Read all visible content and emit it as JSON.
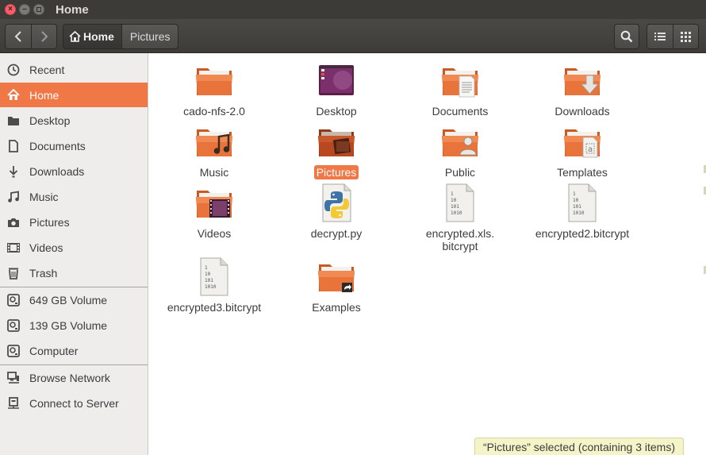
{
  "window": {
    "title": "Home"
  },
  "toolbar": {
    "back_icon": "chevron-left",
    "forward_icon": "chevron-right",
    "breadcrumbs": [
      "Home",
      "Pictures"
    ],
    "search_icon": "search",
    "list_view_icon": "list-view",
    "grid_view_icon": "grid-view"
  },
  "sidebar": {
    "items": [
      {
        "label": "Recent",
        "icon": "clock-icon"
      },
      {
        "label": "Home",
        "icon": "home-icon",
        "selected": true
      },
      {
        "label": "Desktop",
        "icon": "folder-icon"
      },
      {
        "label": "Documents",
        "icon": "document-icon"
      },
      {
        "label": "Downloads",
        "icon": "download-icon"
      },
      {
        "label": "Music",
        "icon": "music-icon"
      },
      {
        "label": "Pictures",
        "icon": "camera-icon"
      },
      {
        "label": "Videos",
        "icon": "film-icon"
      },
      {
        "label": "Trash",
        "icon": "trash-icon"
      }
    ],
    "devices": [
      {
        "label": "649 GB Volume",
        "icon": "drive-icon"
      },
      {
        "label": "139 GB Volume",
        "icon": "drive-icon"
      },
      {
        "label": "Computer",
        "icon": "drive-icon"
      }
    ],
    "network": [
      {
        "label": "Browse Network",
        "icon": "network-icon"
      },
      {
        "label": "Connect to Server",
        "icon": "server-icon"
      }
    ]
  },
  "files": [
    {
      "name": "cado-nfs-2.0",
      "type": "folder"
    },
    {
      "name": "Desktop",
      "type": "desktop-folder"
    },
    {
      "name": "Documents",
      "type": "documents-folder"
    },
    {
      "name": "Downloads",
      "type": "downloads-folder"
    },
    {
      "name": "Music",
      "type": "music-folder"
    },
    {
      "name": "Pictures",
      "type": "pictures-folder",
      "selected": true
    },
    {
      "name": "Public",
      "type": "public-folder"
    },
    {
      "name": "Templates",
      "type": "templates-folder"
    },
    {
      "name": "Videos",
      "type": "videos-folder"
    },
    {
      "name": "decrypt.py",
      "type": "python-file"
    },
    {
      "name_line1": "encrypted.xls.",
      "name_line2": "bitcrypt",
      "type": "binary-file"
    },
    {
      "name": "encrypted2.bitcrypt",
      "type": "binary-file"
    },
    {
      "name": "encrypted3.bitcrypt",
      "type": "binary-file"
    },
    {
      "name": "Examples",
      "type": "link-folder"
    }
  ],
  "binary_glyph_lines": [
    "1",
    "10",
    "101",
    "1010"
  ],
  "status": {
    "text": "“Pictures” selected  (containing 3 items)"
  },
  "colors": {
    "accent": "#f07746",
    "folder": "#e8743b",
    "titlebar": "#3c3b37"
  }
}
